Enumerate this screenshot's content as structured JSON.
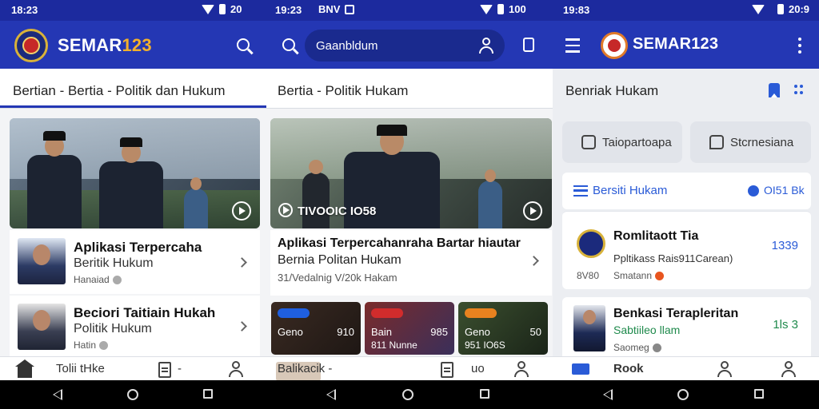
{
  "status_bar": {
    "panel1_time": "18:23",
    "panel1_right": "20",
    "panel2_time": "19:23",
    "panel2_extra": "BNV",
    "panel2_right": "100",
    "panel3_time": "19:83",
    "panel3_right": "20:9"
  },
  "panel1": {
    "brand_white": "SEMAR",
    "brand_yellow": "123",
    "tab_title": "Bertian - Bertia - Politik dan Hukum",
    "articles": [
      {
        "title": "Aplikasi Terpercaha",
        "subtitle": "Beritik Hukum",
        "meta": "Hanaiad"
      },
      {
        "title": "Beciori Taitiain Hukah",
        "subtitle": "Politik  Hukum",
        "meta": "Hatin"
      }
    ],
    "bottom_nav": {
      "label": "Tolii tHke",
      "second": "-"
    }
  },
  "panel2": {
    "search_placeholder": "Gaanbldum",
    "tab_title": "Bertia - Politik Hukam",
    "hero_caption": "TIVOOIC IO58",
    "article": {
      "title": "Aplikasi Terpercahanraha Bartar hiautar",
      "subtitle": "Bernia Politan Hukam",
      "meta": "31/Vedalnig V/20k Hakam"
    },
    "mini_cards": [
      {
        "title": "Geno",
        "right": "910",
        "sub": "",
        "badge_color": "#1f5fe0"
      },
      {
        "title": "Bain",
        "right": "985",
        "sub": "811 Nunne",
        "badge_color": "#d12c2c"
      },
      {
        "title": "Geno",
        "right": "50",
        "sub": "951 IO6S",
        "badge_color": "#e8821f"
      }
    ],
    "bottom_nav": {
      "label": "Balikacik -",
      "right": "uo"
    }
  },
  "panel3": {
    "brand": "SEMAR123",
    "section_title": "Benriak Hukam",
    "chips": [
      "Taiopartoapa",
      "Stcrnesiana"
    ],
    "list_header": {
      "title": "Bersiti Hukam",
      "count": "OI51 Bk"
    },
    "items": [
      {
        "title": "Romlitaott Tia",
        "subtitle": "Ppltikass Rais911Carean)",
        "meta_left": "8V80",
        "meta": "Smatann",
        "count": "1339",
        "count_color": "#2a5bd7",
        "dot_color": "#e8551f"
      },
      {
        "title": "Benkasi Terapleritan",
        "subtitle": "Sabtiileo llam",
        "meta_left": "",
        "meta": "Saomeg",
        "count": "1ls 3",
        "count_color": "#1f8a4c",
        "dot_color": "#888888"
      }
    ],
    "bottom_nav": {
      "label": "Rook"
    }
  },
  "colors": {
    "appbar": "#2437b4",
    "accent_yellow": "#f2b02c",
    "link_blue": "#2a5bd7"
  }
}
